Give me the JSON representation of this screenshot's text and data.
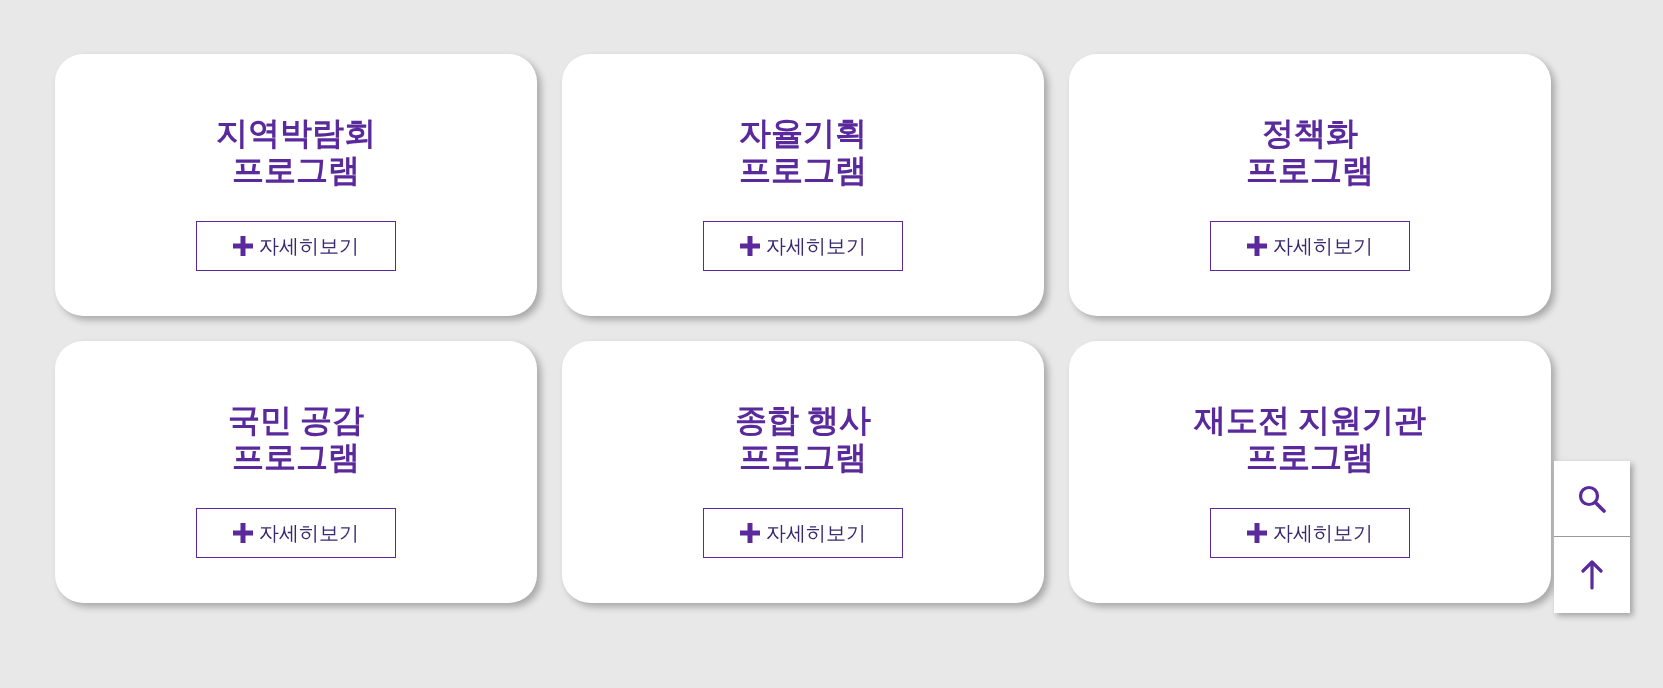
{
  "cards": [
    {
      "title_lines": [
        "지역박람회",
        "프로그램"
      ],
      "button": "자세히보기"
    },
    {
      "title_lines": [
        "자율기획",
        "프로그램"
      ],
      "button": "자세히보기"
    },
    {
      "title_lines": [
        "정책화",
        "프로그램"
      ],
      "button": "자세히보기"
    },
    {
      "title_lines": [
        "국민 공감",
        "프로그램"
      ],
      "button": "자세히보기"
    },
    {
      "title_lines": [
        "종합 행사",
        "프로그램"
      ],
      "button": "자세히보기"
    },
    {
      "title_lines": [
        "재도전 지원기관",
        "프로그램"
      ],
      "button": "자세히보기"
    }
  ],
  "floating_buttons": [
    {
      "kind": "search"
    },
    {
      "kind": "top"
    }
  ]
}
